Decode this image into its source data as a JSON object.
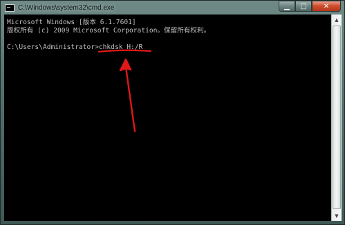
{
  "window": {
    "title": "C:\\Windows\\system32\\cmd.exe",
    "controls": {
      "minimize": "▁",
      "maximize": "□",
      "close": "✕"
    }
  },
  "console": {
    "lines": [
      "Microsoft Windows [版本 6.1.7601]",
      "版权所有 (c) 2009 Microsoft Corporation。保留所有权利。",
      "",
      "C:\\Users\\Administrator>chkdsk H:/R"
    ]
  },
  "scrollbar": {
    "up": "▲",
    "down": "▼"
  },
  "colors": {
    "console_bg": "#000000",
    "console_text": "#c0c0c0",
    "annotation_red": "#e01818"
  },
  "icons": {
    "window_icon": "cmd-icon",
    "arrow": "red-arrow-icon",
    "underline": "red-underline"
  }
}
